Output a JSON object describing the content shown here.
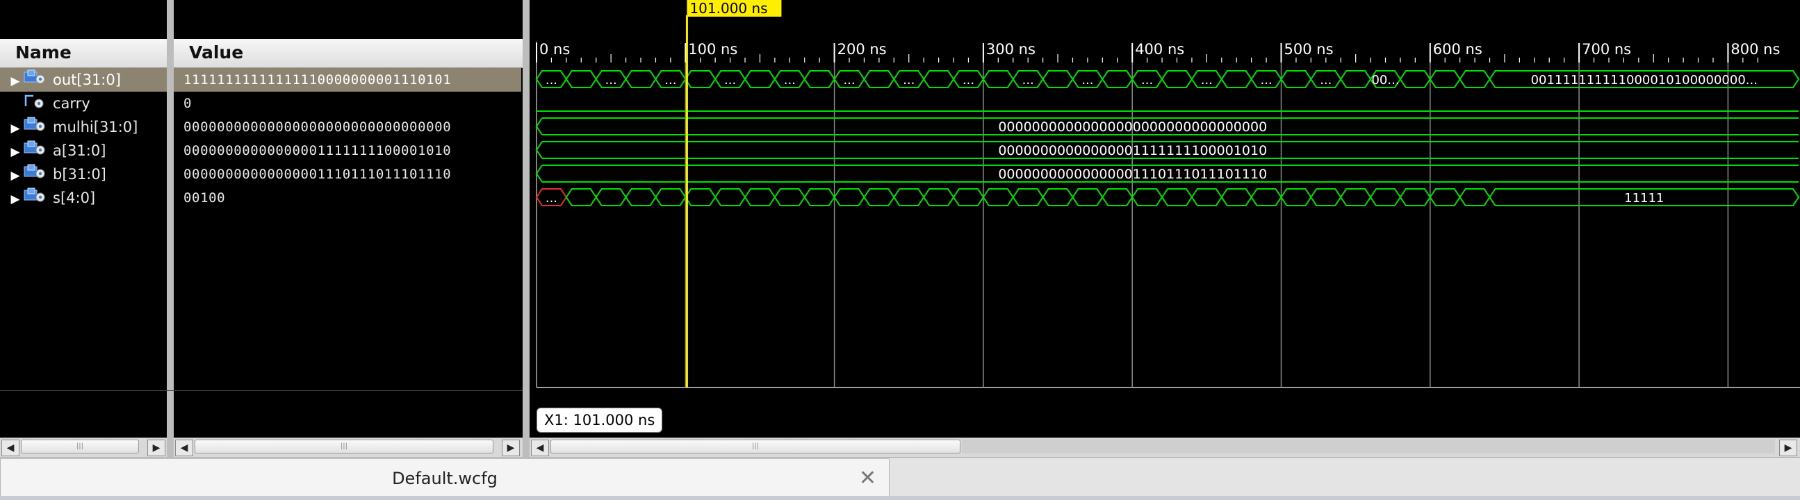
{
  "columns": {
    "name": "Name",
    "value": "Value"
  },
  "signals": [
    {
      "name": "out[31:0]",
      "value": "11111111111111110000000001110101",
      "icon": "bus-icon",
      "expandable": true,
      "selected": true
    },
    {
      "name": "carry",
      "value": "0",
      "icon": "bit-signal-icon",
      "expandable": false,
      "selected": false
    },
    {
      "name": "mulhi[31:0]",
      "value": "00000000000000000000000000000000",
      "icon": "bus-icon",
      "expandable": true,
      "selected": false
    },
    {
      "name": "a[31:0]",
      "value": "00000000000000001111111100001010",
      "icon": "bus-icon",
      "expandable": true,
      "selected": false
    },
    {
      "name": "b[31:0]",
      "value": "00000000000000001110111011101110",
      "icon": "bus-icon",
      "expandable": true,
      "selected": false
    },
    {
      "name": "s[4:0]",
      "value": "00100",
      "icon": "bus-icon",
      "expandable": true,
      "selected": false
    }
  ],
  "timeline": {
    "ticks": [
      "0 ns",
      "100 ns",
      "200 ns",
      "300 ns",
      "400 ns",
      "500 ns",
      "600 ns",
      "700 ns",
      "800 ns"
    ],
    "range_ns": [
      0,
      800
    ],
    "cursor": {
      "label": "101.000 ns",
      "time_ns": 101
    },
    "marker_label": "X1: 101.000 ns"
  },
  "waves": {
    "out": {
      "ellipsis": "...",
      "label_a": "00...",
      "label_b": "00...",
      "tail": "001111111111000010100000000..."
    },
    "mulhi": "00000000000000000000000000000000",
    "a": "00000000000000001111111100001010",
    "b": "00000000000000001110111011101110",
    "s_first": "...",
    "s_tail": "11111"
  },
  "tabs": [
    {
      "label": "Default.wcfg"
    }
  ],
  "colors": {
    "wave": "#00e000",
    "cursor": "#ffee00",
    "grid": "#8c8c8c",
    "error": "#e03030"
  }
}
